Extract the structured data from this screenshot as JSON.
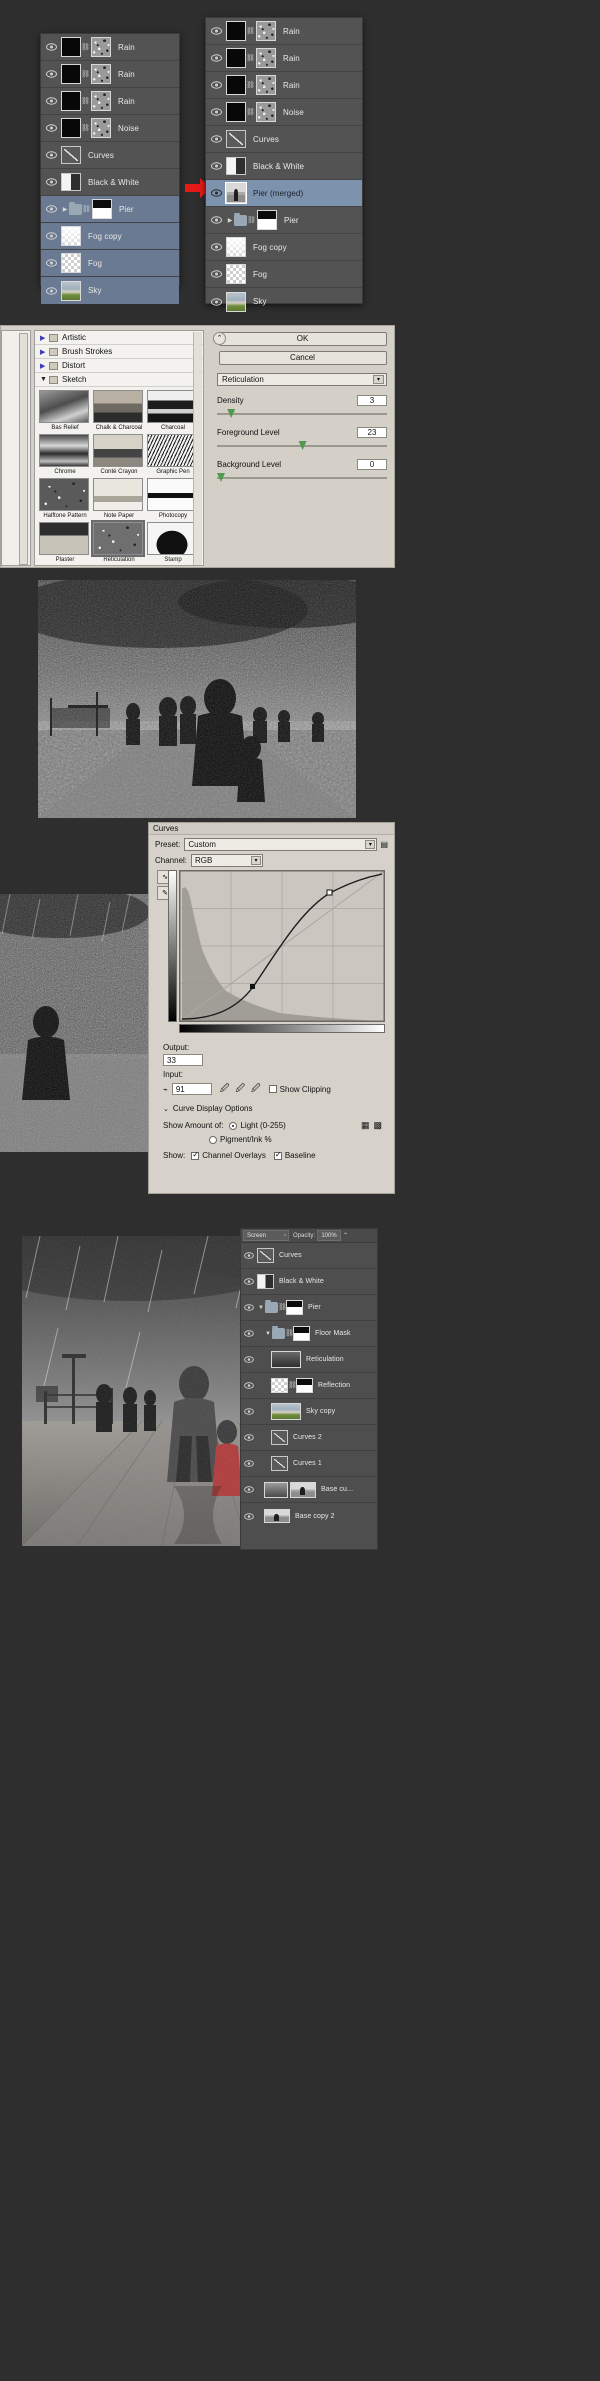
{
  "section1": {
    "name": "layers-panel-comparison",
    "left_panel": {
      "rows": [
        {
          "name": "Rain",
          "type": "mask-image",
          "selected": false
        },
        {
          "name": "Rain",
          "type": "mask-image",
          "selected": false
        },
        {
          "name": "Rain",
          "type": "mask-image",
          "selected": false
        },
        {
          "name": "Noise",
          "type": "mask-image",
          "selected": false
        },
        {
          "name": "Curves",
          "type": "adjustment-curves",
          "selected": false
        },
        {
          "name": "Black & White",
          "type": "adjustment-bw",
          "selected": false
        },
        {
          "name": "Pier",
          "type": "group",
          "selected": true
        },
        {
          "name": "Fog copy",
          "type": "pixel",
          "selected": true
        },
        {
          "name": "Fog",
          "type": "pixel",
          "selected": true
        },
        {
          "name": "Sky",
          "type": "pixel",
          "selected": true
        }
      ]
    },
    "right_panel": {
      "rows": [
        {
          "name": "Rain",
          "type": "mask-image",
          "selected": false
        },
        {
          "name": "Rain",
          "type": "mask-image",
          "selected": false
        },
        {
          "name": "Rain",
          "type": "mask-image",
          "selected": false
        },
        {
          "name": "Noise",
          "type": "mask-image",
          "selected": false
        },
        {
          "name": "Curves",
          "type": "adjustment-curves",
          "selected": false
        },
        {
          "name": "Black & White",
          "type": "adjustment-bw",
          "selected": false
        },
        {
          "name": "Pier (merged)",
          "type": "pixel",
          "selected": true
        },
        {
          "name": "Pier",
          "type": "group",
          "selected": false
        },
        {
          "name": "Fog copy",
          "type": "pixel",
          "selected": false
        },
        {
          "name": "Fog",
          "type": "pixel",
          "selected": false
        },
        {
          "name": "Sky",
          "type": "pixel",
          "selected": false
        }
      ]
    },
    "arrow": {
      "icon": "red-right-arrow",
      "color": "#e61919"
    }
  },
  "filter_gallery": {
    "buttons": {
      "ok": "OK",
      "cancel": "Cancel"
    },
    "filter_select": "Reticulation",
    "tree": [
      {
        "label": "Artistic",
        "open": false
      },
      {
        "label": "Brush Strokes",
        "open": false
      },
      {
        "label": "Distort",
        "open": false
      },
      {
        "label": "Sketch",
        "open": true
      }
    ],
    "thumbnails": [
      {
        "label": "Bas Relief",
        "selected": false
      },
      {
        "label": "Chalk & Charcoal",
        "selected": false
      },
      {
        "label": "Charcoal",
        "selected": false
      },
      {
        "label": "Chrome",
        "selected": false
      },
      {
        "label": "Conté Crayon",
        "selected": false
      },
      {
        "label": "Graphic Pen",
        "selected": false
      },
      {
        "label": "Halftone Pattern",
        "selected": false
      },
      {
        "label": "Note Paper",
        "selected": false
      },
      {
        "label": "Photocopy",
        "selected": false
      },
      {
        "label": "Plaster",
        "selected": false
      },
      {
        "label": "Reticulation",
        "selected": true
      },
      {
        "label": "Stamp",
        "selected": false
      }
    ],
    "params": [
      {
        "label": "Density",
        "value": "3"
      },
      {
        "label": "Foreground Level",
        "value": "23"
      },
      {
        "label": "Background Level",
        "value": "0"
      }
    ],
    "collapse_icon": "collapse-chevron-icon"
  },
  "bw_preview": {
    "name": "reticulation-bw-pier-preview"
  },
  "curves": {
    "title": "Curves",
    "preset_label": "Preset:",
    "preset_value": "Custom",
    "channel_label": "Channel:",
    "channel_value": "RGB",
    "output_label": "Output:",
    "output_value": "33",
    "input_label": "Input:",
    "input_value": "91",
    "show_clipping": "Show Clipping",
    "display_options": "Curve Display Options",
    "show_amount_label": "Show Amount of:",
    "light_option": "Light  (0-255)",
    "pigment_option": "Pigment/Ink %",
    "show_label": "Show:",
    "channel_overlays": "Channel Overlays",
    "baseline": "Baseline",
    "tools": [
      "curve-pencil-icon",
      "draw-pencil-icon",
      "smooth-icon",
      "eyedropper-black-icon",
      "eyedropper-gray-icon",
      "eyedropper-white-icon"
    ],
    "grid_small_icon": "grid-small-icon",
    "grid_large_icon": "grid-large-icon",
    "points": [
      {
        "input": 91,
        "output": 33
      },
      {
        "input": 190,
        "output": 205
      }
    ]
  },
  "crop_preview": {
    "name": "rain-crop-preview"
  },
  "final": {
    "image_name": "final-rainy-pier-composite",
    "panel": {
      "blend_mode": "Screen",
      "opacity_label": "Opacity:",
      "opacity_value": "100%",
      "rows": [
        {
          "name": "Curves",
          "type": "adjustment-curves",
          "indent": 0
        },
        {
          "name": "Black & White",
          "type": "adjustment-bw",
          "indent": 0
        },
        {
          "name": "Pier",
          "type": "group",
          "indent": 0
        },
        {
          "name": "Floor Mask",
          "type": "group-mask",
          "indent": 1
        },
        {
          "name": "Reticulation",
          "type": "pixel",
          "indent": 2
        },
        {
          "name": "Reflection",
          "type": "mask-image",
          "indent": 2
        },
        {
          "name": "Sky copy",
          "type": "pixel",
          "indent": 2
        },
        {
          "name": "Curves 2",
          "type": "adjustment-curves",
          "indent": 2
        },
        {
          "name": "Curves 1",
          "type": "adjustment-curves",
          "indent": 2
        },
        {
          "name": "Base cu...",
          "type": "mask-image",
          "indent": 2
        },
        {
          "name": "Base copy 2",
          "type": "pixel",
          "indent": 2
        }
      ]
    }
  }
}
